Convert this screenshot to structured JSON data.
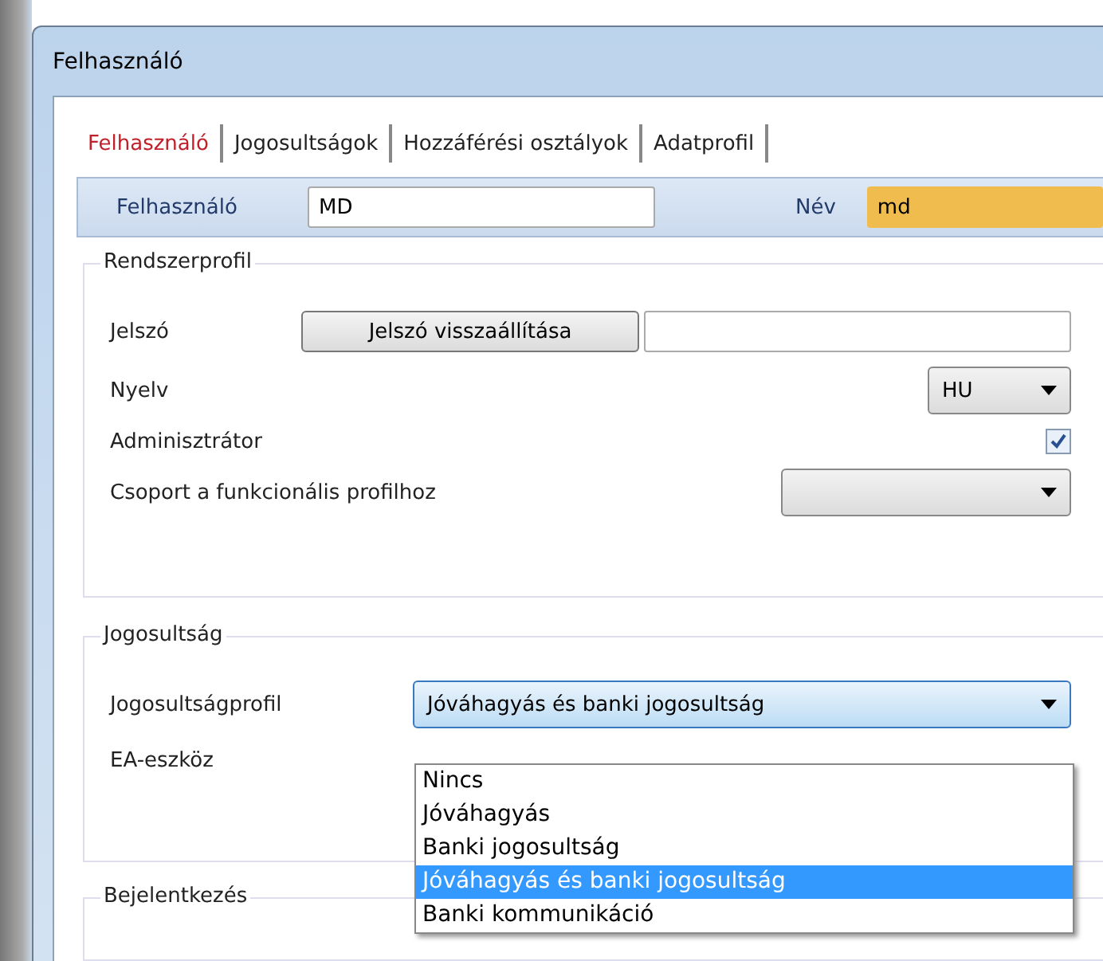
{
  "window": {
    "title": "Felhasználó"
  },
  "tabs": [
    {
      "label": "Felhasználó",
      "selected": true
    },
    {
      "label": "Jogosultságok",
      "selected": false
    },
    {
      "label": "Hozzáférési osztályok",
      "selected": false
    },
    {
      "label": "Adatprofil",
      "selected": false
    }
  ],
  "header": {
    "user_label": "Felhasználó",
    "user_value": "MD",
    "name_label": "Név",
    "name_value": "md"
  },
  "system_profile": {
    "title": "Rendszerprofil",
    "password_label": "Jelszó",
    "reset_button": "Jelszó visszaállítása",
    "language_label": "Nyelv",
    "language_value": "HU",
    "admin_label": "Adminisztrátor",
    "admin_checked": true,
    "group_label": "Csoport a funkcionális profilhoz"
  },
  "rights": {
    "title": "Jogosultság",
    "profile_label": "Jogosultságprofil",
    "profile_value": "Jóváhagyás és banki jogosultság",
    "device_label": "EA-eszköz",
    "options": [
      {
        "label": "Nincs",
        "selected": false
      },
      {
        "label": "Jóváhagyás",
        "selected": false
      },
      {
        "label": "Banki jogosultság",
        "selected": false
      },
      {
        "label": "Jóváhagyás és banki jogosultság",
        "selected": true
      },
      {
        "label": "Banki kommunikáció",
        "selected": false
      }
    ]
  },
  "login": {
    "title": "Bejelentkezés"
  }
}
